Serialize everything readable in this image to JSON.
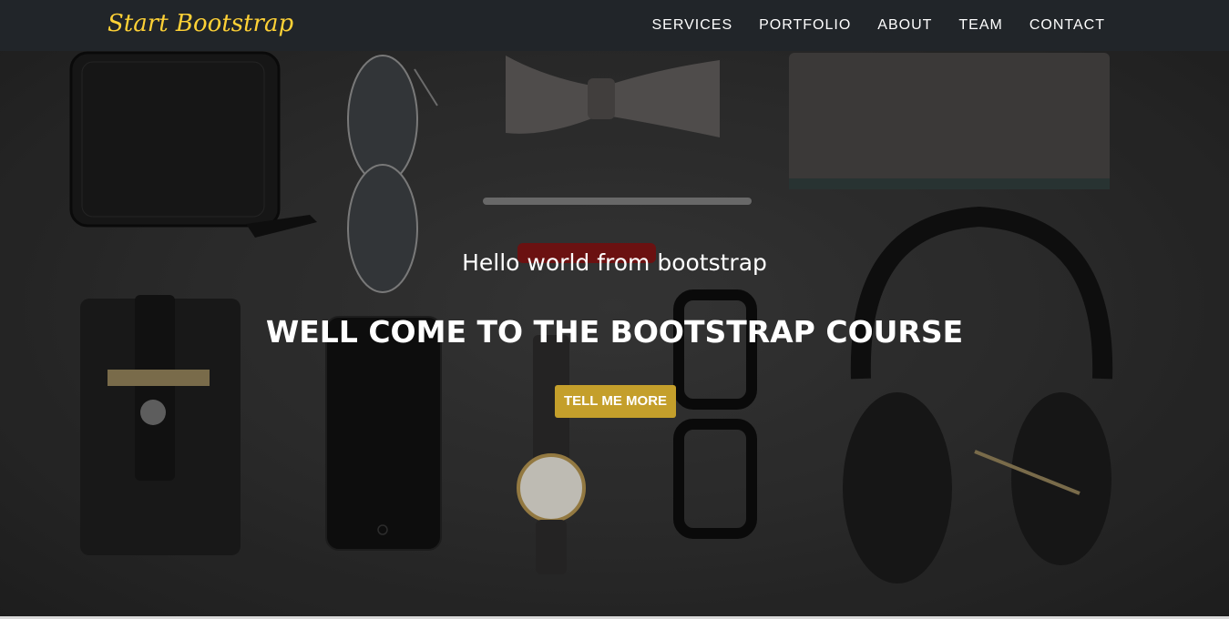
{
  "navbar": {
    "brand": "Start Bootstrap",
    "links": [
      {
        "label": "SERVICES"
      },
      {
        "label": "PORTFOLIO"
      },
      {
        "label": "ABOUT"
      },
      {
        "label": "TEAM"
      },
      {
        "label": "CONTACT"
      }
    ]
  },
  "hero": {
    "subheading": "Hello world from bootstrap",
    "heading": "WELL COME TO THE BOOTSTRAP COURSE",
    "button_label": "TELL ME MORE"
  },
  "colors": {
    "navbar_bg": "#212529",
    "brand": "#fed136",
    "button_bg": "#c49f2b",
    "text": "#ffffff"
  }
}
